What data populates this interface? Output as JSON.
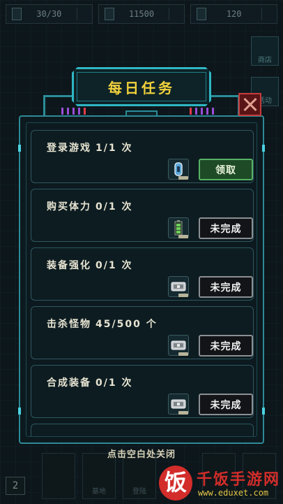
{
  "resources": [
    {
      "icon": "battery-icon",
      "value": "30/30"
    },
    {
      "icon": "coin-icon",
      "value": "11500"
    },
    {
      "icon": "energy-icon",
      "value": "120"
    }
  ],
  "side_buttons": [
    {
      "label": "商店",
      "icon": "shop-icon"
    },
    {
      "label": "活动",
      "icon": "event-icon"
    }
  ],
  "dialog": {
    "title": "每日任务",
    "hint": "点击空白处关闭"
  },
  "tasks": [
    {
      "name": "登录游戏",
      "progress": "1/1 次",
      "reward_icon": "gem-capsule-icon",
      "action": "领取",
      "action_state": "claim"
    },
    {
      "name": "购买体力",
      "progress": "0/1 次",
      "reward_icon": "battery-cell-icon",
      "action": "未完成",
      "action_state": "incomplete"
    },
    {
      "name": "装备强化",
      "progress": "0/1 次",
      "reward_icon": "equipment-chest-icon",
      "action": "未完成",
      "action_state": "incomplete"
    },
    {
      "name": "击杀怪物",
      "progress": "45/500 个",
      "reward_icon": "equipment-chest-icon",
      "action": "未完成",
      "action_state": "incomplete"
    },
    {
      "name": "合成装备",
      "progress": "0/1 次",
      "reward_icon": "equipment-chest-icon",
      "action": "未完成",
      "action_state": "incomplete"
    }
  ],
  "bottom_nav": [
    {
      "label": ""
    },
    {
      "label": "基地"
    },
    {
      "label": "登陆"
    },
    {
      "label": ""
    },
    {
      "label": ""
    }
  ],
  "level": "2",
  "watermark": {
    "logo_char": "饭",
    "title": "千饭手游网",
    "url": "www.eduxet.com"
  },
  "colors": {
    "title_yellow": "#f2d23c",
    "frame_cyan": "#2fb7c4",
    "claim_green": "#56b264",
    "close_red": "#c63c3c",
    "watermark_red": "#d22d2a"
  }
}
